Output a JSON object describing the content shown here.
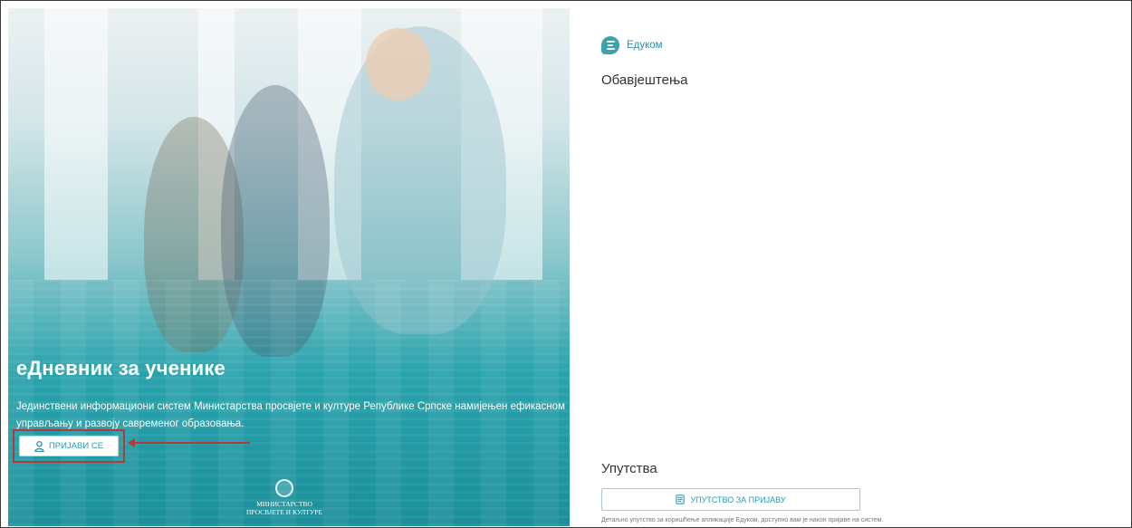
{
  "hero": {
    "title": "еДневник за ученике",
    "description": "Јединствени информациони систем Министарства просвјете и културе Републике Српске намијењен ефикасном управљању и развоју савременог образовања.",
    "login_label": "ПРИЈАВИ СЕ",
    "ministry_line1": "МИНИСТАРСТВО",
    "ministry_line2": "ПРОСВЈЕТЕ И КУЛТУРЕ"
  },
  "right": {
    "brand_name": "Едуком",
    "notices_title": "Обавјештења",
    "guides_title": "Упутства",
    "guide_button_label": "УПУТСТВО ЗА ПРИЈАВУ",
    "guide_note": "Детаљно упутство за коришћење апликације Едуком, доступно вам је након пријаве на систем."
  },
  "colors": {
    "accent": "#2a9bb0",
    "hero_teal": "#1a8f9a",
    "highlight_red": "#b23a3a"
  },
  "icons": [
    "user-icon",
    "document-icon",
    "seal-icon",
    "edukom-logo-icon"
  ]
}
